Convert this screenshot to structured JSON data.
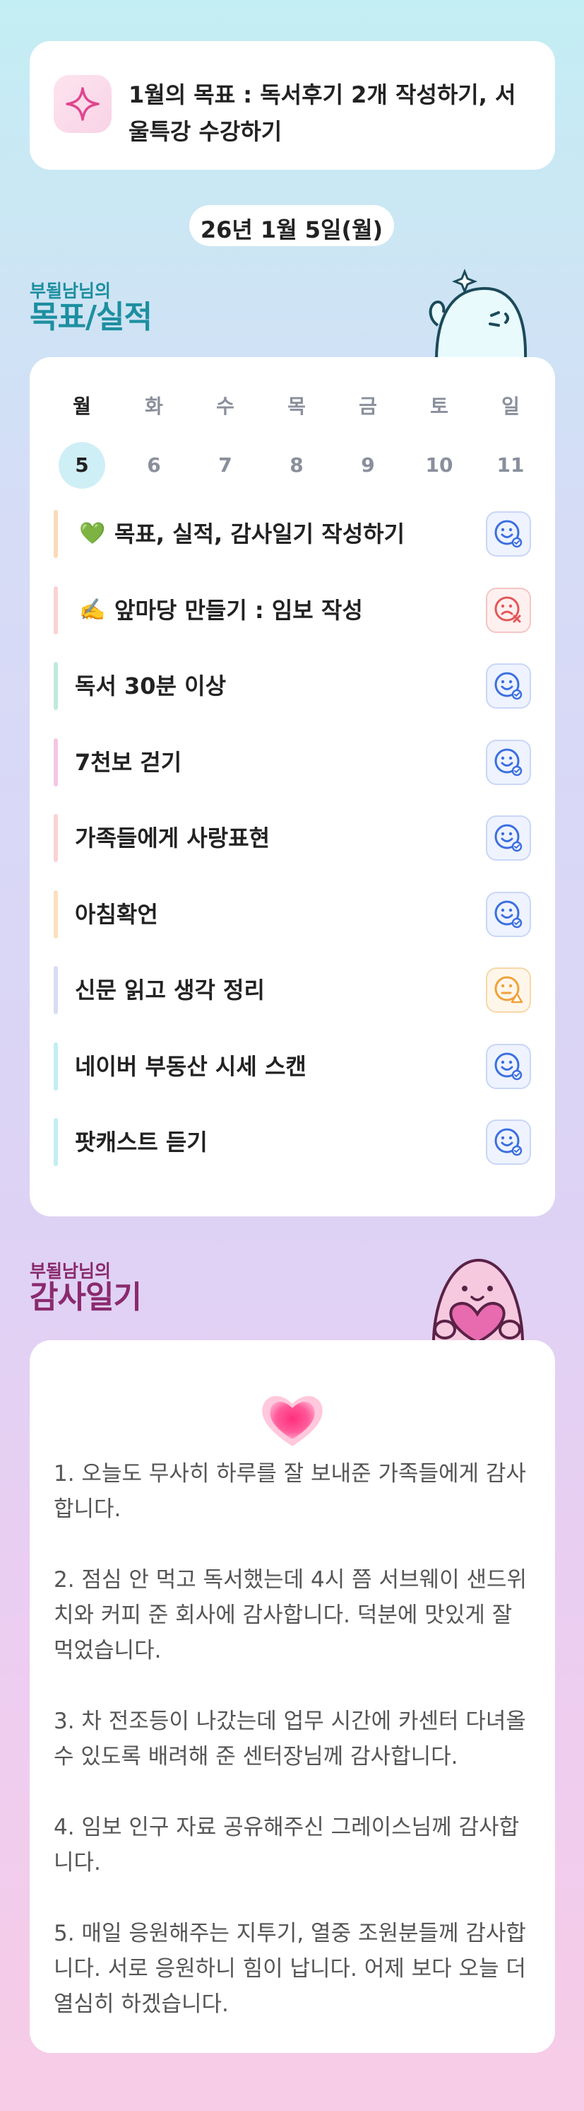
{
  "goal": {
    "text": "1월의 목표 : 독서후기 2개 작성하기, 서울특강 수강하기",
    "icon": "sparkle-icon"
  },
  "date": "26년 1월 5일(월)",
  "goals_section": {
    "small": "부될남님의",
    "title": "목표/실적"
  },
  "week": [
    {
      "name": "월",
      "num": "5",
      "active": true
    },
    {
      "name": "화",
      "num": "6"
    },
    {
      "name": "수",
      "num": "7"
    },
    {
      "name": "목",
      "num": "8"
    },
    {
      "name": "금",
      "num": "9"
    },
    {
      "name": "토",
      "num": "10"
    },
    {
      "name": "일",
      "num": "11"
    }
  ],
  "tasks": [
    {
      "emoji": "💚",
      "label": "목표, 실적, 감사일기 작성하기",
      "bar": "#fbd9b8",
      "status": "smile-check"
    },
    {
      "emoji": "✍️",
      "label": "앞마당 만들기 : 임보 작성",
      "bar": "#fbd2d2",
      "status": "sad-x"
    },
    {
      "emoji": "",
      "label": "독서 30분 이상",
      "bar": "#bfe9de",
      "status": "smile-check"
    },
    {
      "emoji": "",
      "label": "7천보 걷기",
      "bar": "#f5c6e4",
      "status": "smile-check"
    },
    {
      "emoji": "",
      "label": "가족들에게 사랑표현",
      "bar": "#fbd2d2",
      "status": "smile-check"
    },
    {
      "emoji": "",
      "label": "아침확언",
      "bar": "#fce0bd",
      "status": "smile-check"
    },
    {
      "emoji": "",
      "label": "신문 읽고 생각 정리",
      "bar": "#d8dcf4",
      "status": "neutral-warning"
    },
    {
      "emoji": "",
      "label": "네이버 부동산 시세 스캔",
      "bar": "#c2eef2",
      "status": "smile-check"
    },
    {
      "emoji": "",
      "label": "팟캐스트 듣기",
      "bar": "#c2eef2",
      "status": "smile-check"
    }
  ],
  "thanks_section": {
    "small": "부될남님의",
    "title": "감사일기"
  },
  "thanks": [
    "1. 오늘도 무사히 하루를 잘 보내준 가족들에게 감사합니다.",
    "2. 점심 안 먹고 독서했는데 4시 쯤 서브웨이 샌드위치와 커피 준 회사에 감사합니다. 덕분에 맛있게 잘 먹었습니다.",
    "3. 차 전조등이 나갔는데 업무 시간에 카센터 다녀올 수 있도록 배려해 준 센터장님께 감사합니다.",
    "4. 임보 인구 자료 공유해주신 그레이스님께 감사합니다.",
    "5. 매일 응원해주는 지투기, 열중 조원분들께 감사합니다. 서로 응원하니 힘이 납니다. 어제 보다 오늘 더 열심히 하겠습니다."
  ],
  "colors": {
    "teal_title": "#1d8fa0",
    "purple_title": "#8a2a6e",
    "smile_blue": "#3b6fe0",
    "sad_red": "#e45757",
    "warn_orange": "#f0a23a"
  }
}
